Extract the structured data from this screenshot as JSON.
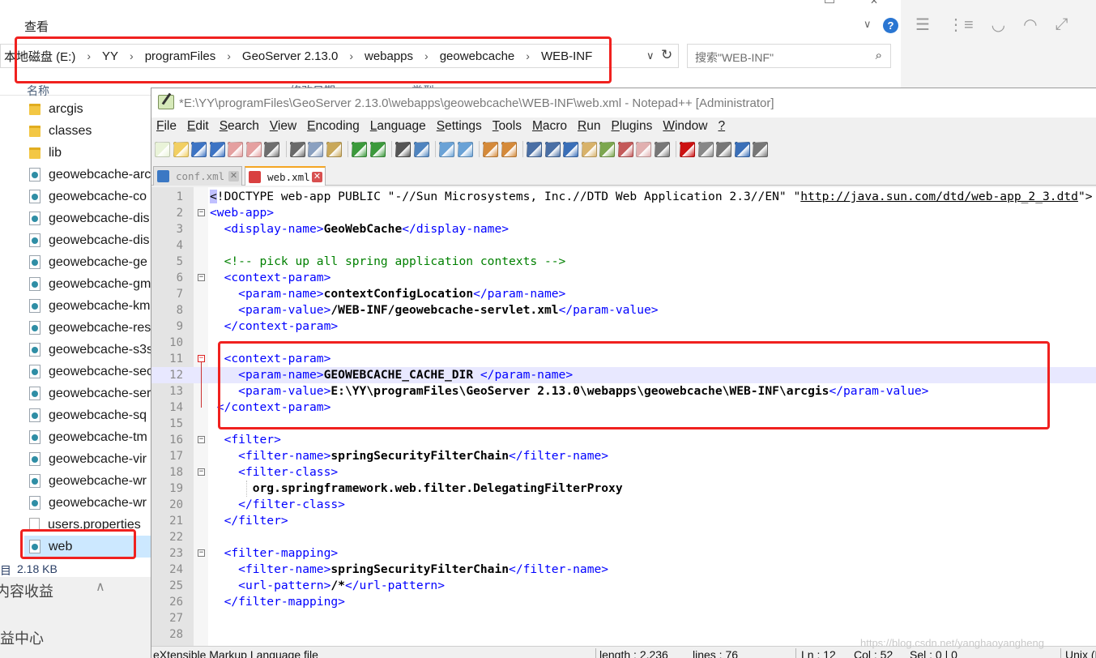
{
  "explorer": {
    "ribbon_tab": "查看",
    "breadcrumb": [
      "本地磁盘 (E:)",
      "YY",
      "programFiles",
      "GeoServer 2.13.0",
      "webapps",
      "geowebcache",
      "WEB-INF"
    ],
    "search_placeholder": "搜索\"WEB-INF\"",
    "column_name": "名称",
    "column_date": "修改日期",
    "column_type": "类型",
    "files": [
      {
        "name": "arcgis",
        "icon": "folder-icon"
      },
      {
        "name": "classes",
        "icon": "folder-icon"
      },
      {
        "name": "lib",
        "icon": "folder-icon"
      },
      {
        "name": "geowebcache-arc",
        "icon": "xml-file-icon"
      },
      {
        "name": "geowebcache-co",
        "icon": "xml-file-icon"
      },
      {
        "name": "geowebcache-dis",
        "icon": "xml-file-icon"
      },
      {
        "name": "geowebcache-dis",
        "icon": "xml-file-icon"
      },
      {
        "name": "geowebcache-ge",
        "icon": "xml-file-icon"
      },
      {
        "name": "geowebcache-gm",
        "icon": "xml-file-icon"
      },
      {
        "name": "geowebcache-km",
        "icon": "xml-file-icon"
      },
      {
        "name": "geowebcache-res",
        "icon": "xml-file-icon"
      },
      {
        "name": "geowebcache-s3s",
        "icon": "xml-file-icon"
      },
      {
        "name": "geowebcache-sec",
        "icon": "xml-file-icon"
      },
      {
        "name": "geowebcache-ser",
        "icon": "xml-file-icon"
      },
      {
        "name": "geowebcache-sq",
        "icon": "xml-file-icon"
      },
      {
        "name": "geowebcache-tm",
        "icon": "xml-file-icon"
      },
      {
        "name": "geowebcache-vir",
        "icon": "xml-file-icon"
      },
      {
        "name": "geowebcache-wr",
        "icon": "xml-file-icon"
      },
      {
        "name": "geowebcache-wr",
        "icon": "xml-file-icon"
      },
      {
        "name": "users.properties",
        "icon": "document-icon"
      },
      {
        "name": "web",
        "icon": "xml-file-icon",
        "selected": true
      }
    ],
    "status_count": "目",
    "status_size": "2.18 KB",
    "nav_item_1": "内容收益",
    "nav_item_2": "益中心"
  },
  "npp": {
    "title": "*E:\\YY\\programFiles\\GeoServer 2.13.0\\webapps\\geowebcache\\WEB-INF\\web.xml - Notepad++ [Administrator]",
    "menu": [
      {
        "label": "File",
        "u": "F",
        "rest": "ile"
      },
      {
        "label": "Edit",
        "u": "E",
        "rest": "dit"
      },
      {
        "label": "Search",
        "u": "S",
        "rest": "earch"
      },
      {
        "label": "View",
        "u": "V",
        "rest": "iew"
      },
      {
        "label": "Encoding",
        "u": "E",
        "rest": "ncoding"
      },
      {
        "label": "Language",
        "u": "L",
        "rest": "anguage"
      },
      {
        "label": "Settings",
        "u": "S",
        "rest": "ettings"
      },
      {
        "label": "Tools",
        "u": "T",
        "rest": "ools"
      },
      {
        "label": "Macro",
        "u": "M",
        "rest": "acro"
      },
      {
        "label": "Run",
        "u": "R",
        "rest": "un"
      },
      {
        "label": "Plugins",
        "u": "P",
        "rest": "lugins"
      },
      {
        "label": "Window",
        "u": "W",
        "rest": "indow"
      },
      {
        "label": "?",
        "u": "?",
        "rest": ""
      }
    ],
    "tabs": [
      {
        "label": "conf.xml",
        "active": false
      },
      {
        "label": "web.xml",
        "active": true
      }
    ],
    "current_line": 12,
    "lines": [
      {
        "n": "1",
        "fold": "",
        "segs": [
          [
            "dtb",
            "<"
          ],
          [
            "dt",
            "!DOCTYPE web-app PUBLIC \"-//Sun Microsystems, Inc.//DTD Web Application 2.3//EN\" \""
          ],
          [
            "url",
            "http://java.sun.com/dtd/web-app_2_3.dtd"
          ],
          [
            "dt",
            "\">"
          ]
        ]
      },
      {
        "n": "2",
        "fold": "minus",
        "segs": [
          [
            "tag",
            "<web-app>"
          ]
        ]
      },
      {
        "n": "3",
        "fold": "",
        "segs": [
          [
            "sp",
            "  "
          ],
          [
            "tag",
            "<display-name>"
          ],
          [
            "txt",
            "GeoWebCache"
          ],
          [
            "tag",
            "</display-name>"
          ]
        ]
      },
      {
        "n": "4",
        "fold": "",
        "segs": []
      },
      {
        "n": "5",
        "fold": "",
        "segs": [
          [
            "sp",
            "  "
          ],
          [
            "com",
            "<!-- pick up all spring application contexts -->"
          ]
        ]
      },
      {
        "n": "6",
        "fold": "minus",
        "segs": [
          [
            "sp",
            "  "
          ],
          [
            "tag",
            "<context-param>"
          ]
        ]
      },
      {
        "n": "7",
        "fold": "",
        "segs": [
          [
            "sp",
            "    "
          ],
          [
            "tag",
            "<param-name>"
          ],
          [
            "txt",
            "contextConfigLocation"
          ],
          [
            "tag",
            "</param-name>"
          ]
        ]
      },
      {
        "n": "8",
        "fold": "",
        "segs": [
          [
            "sp",
            "    "
          ],
          [
            "tag",
            "<param-value>"
          ],
          [
            "txt",
            "/WEB-INF/geowebcache-servlet.xml"
          ],
          [
            "tag",
            "</param-value>"
          ]
        ]
      },
      {
        "n": "9",
        "fold": "",
        "segs": [
          [
            "sp",
            "  "
          ],
          [
            "tag",
            "</context-param>"
          ]
        ]
      },
      {
        "n": "10",
        "fold": "",
        "segs": []
      },
      {
        "n": "11",
        "fold": "minus-red",
        "segs": [
          [
            "sp",
            "  "
          ],
          [
            "tag",
            "<context-param>"
          ]
        ]
      },
      {
        "n": "12",
        "fold": "",
        "segs": [
          [
            "sp",
            "    "
          ],
          [
            "tag",
            "<param-name>"
          ],
          [
            "txt",
            "GEOWEBCACHE_CACHE_DIR "
          ],
          [
            "tag",
            "</param-name>"
          ]
        ]
      },
      {
        "n": "13",
        "fold": "",
        "segs": [
          [
            "sp",
            "    "
          ],
          [
            "tag",
            "<param-value>"
          ],
          [
            "txt",
            "E:\\YY\\programFiles\\GeoServer 2.13.0\\webapps\\geowebcache\\WEB-INF\\arcgis"
          ],
          [
            "tag",
            "</param-value>"
          ]
        ]
      },
      {
        "n": "14",
        "fold": "",
        "segs": [
          [
            "sp",
            " "
          ],
          [
            "tag",
            "</context-param>"
          ]
        ]
      },
      {
        "n": "15",
        "fold": "",
        "segs": []
      },
      {
        "n": "16",
        "fold": "minus",
        "segs": [
          [
            "sp",
            "  "
          ],
          [
            "tag",
            "<filter>"
          ]
        ]
      },
      {
        "n": "17",
        "fold": "",
        "segs": [
          [
            "sp",
            "    "
          ],
          [
            "tag",
            "<filter-name>"
          ],
          [
            "txt",
            "springSecurityFilterChain"
          ],
          [
            "tag",
            "</filter-name>"
          ]
        ]
      },
      {
        "n": "18",
        "fold": "minus",
        "segs": [
          [
            "sp",
            "    "
          ],
          [
            "tag",
            "<filter-class>"
          ]
        ]
      },
      {
        "n": "19",
        "fold": "",
        "segs": [
          [
            "sp",
            "      "
          ],
          [
            "txt",
            "org.springframework.web.filter.DelegatingFilterProxy"
          ]
        ]
      },
      {
        "n": "20",
        "fold": "",
        "segs": [
          [
            "sp",
            "    "
          ],
          [
            "tag",
            "</filter-class>"
          ]
        ]
      },
      {
        "n": "21",
        "fold": "",
        "segs": [
          [
            "sp",
            "  "
          ],
          [
            "tag",
            "</filter>"
          ]
        ]
      },
      {
        "n": "22",
        "fold": "",
        "segs": []
      },
      {
        "n": "23",
        "fold": "minus",
        "segs": [
          [
            "sp",
            "  "
          ],
          [
            "tag",
            "<filter-mapping>"
          ]
        ]
      },
      {
        "n": "24",
        "fold": "",
        "segs": [
          [
            "sp",
            "    "
          ],
          [
            "tag",
            "<filter-name>"
          ],
          [
            "txt",
            "springSecurityFilterChain"
          ],
          [
            "tag",
            "</filter-name>"
          ]
        ]
      },
      {
        "n": "25",
        "fold": "",
        "segs": [
          [
            "sp",
            "    "
          ],
          [
            "tag",
            "<url-pattern>"
          ],
          [
            "txt",
            "/*"
          ],
          [
            "tag",
            "</url-pattern>"
          ]
        ]
      },
      {
        "n": "26",
        "fold": "",
        "segs": [
          [
            "sp",
            "  "
          ],
          [
            "tag",
            "</filter-mapping>"
          ]
        ]
      },
      {
        "n": "27",
        "fold": "",
        "segs": []
      },
      {
        "n": "28",
        "fold": "",
        "segs": []
      }
    ],
    "status": {
      "filetype": "eXtensible Markup Language file",
      "length": "length : 2,236",
      "lines": "lines : 76",
      "pos": "Ln : 12",
      "col": "Col : 52",
      "sel": "Sel : 0 | 0",
      "eol": "Unix (LF)"
    },
    "watermark": "https://blog.csdn.net/yanghaoyangheng"
  },
  "colors": {
    "highlight_box": "#f0211f",
    "xml_tag": "#0000ff",
    "xml_comment": "#008000",
    "current_line": "#e8e8ff"
  }
}
